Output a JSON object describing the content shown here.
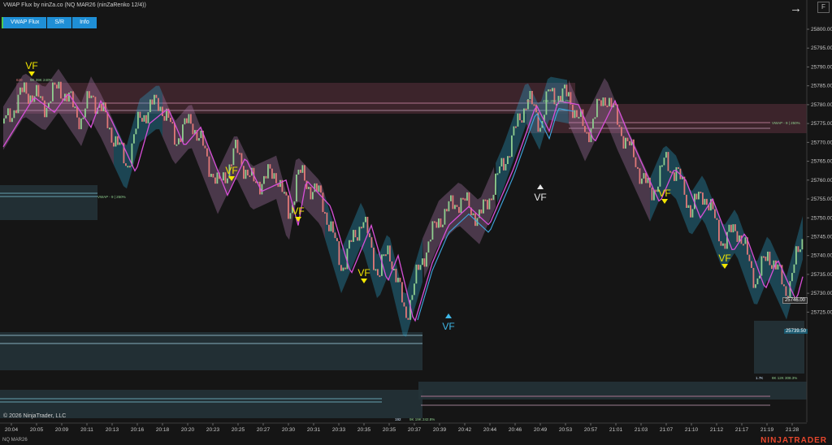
{
  "title": "VWAP Flux by ninZa.co (NQ MAR26 (ninZaRenko 12/4))",
  "toolbar": {
    "vwap_flux": "VWAP Flux",
    "sr": "S/R",
    "info": "Info"
  },
  "top_right": {
    "f_key": "F",
    "arrow_icon": "right-arrow-icon"
  },
  "price_axis": [
    "25800.00",
    "25795.00",
    "25790.00",
    "25785.00",
    "25780.00",
    "25775.00",
    "25770.00",
    "25765.00",
    "25760.00",
    "25755.00",
    "25750.00",
    "25745.00",
    "25740.00",
    "25735.00",
    "25730.00",
    "25725.00"
  ],
  "price_tags": {
    "current": "25746.00",
    "vwap": "25739.50"
  },
  "time_axis": [
    "20:04",
    "20:05",
    "20:09",
    "20:11",
    "20:13",
    "20:16",
    "20:18",
    "20:20",
    "20:23",
    "20:25",
    "20:27",
    "20:30",
    "20:31",
    "20:33",
    "20:35",
    "20:35",
    "20:37",
    "20:39",
    "20:42",
    "20:44",
    "20:46",
    "20:49",
    "20:53",
    "20:57",
    "21:01",
    "21:03",
    "21:07",
    "21:10",
    "21:12",
    "21:17",
    "21:19",
    "21:28"
  ],
  "signals": {
    "label": "VF"
  },
  "annotations": {
    "a1": "620",
    "a1b": "9K 39K 240%",
    "a2": "584",
    "a2b": "49K 29K 183.7%",
    "a3": "192",
    "a3b": "9K 19K 242.8%",
    "a4": "1.7K",
    "a4b": "8K 12K 308.3%",
    "vwap_note": "VWAP - 9 | 250%"
  },
  "copyright": "© 2026 NinjaTrader, LLC",
  "instrument": "NQ MAR26",
  "brand": "NINJATRADER",
  "colors": {
    "bull": "#8fce8f",
    "bear": "#e07878",
    "vwap": "#d84fd8",
    "band_up": "#2aa0c8",
    "band_dn": "#b07ab0"
  }
}
